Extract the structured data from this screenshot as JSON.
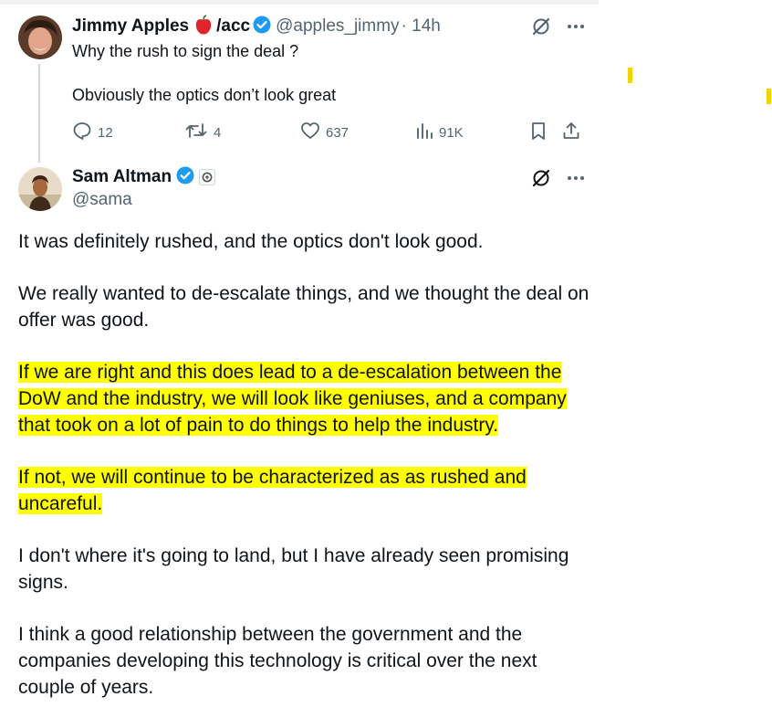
{
  "quoted_tweet": {
    "author_name": "Jimmy Apples",
    "author_suffix": "/acc",
    "handle": "@apples_jimmy",
    "time": "· 14h",
    "lines": [
      "Why the rush to sign the deal ?",
      "Obviously the optics don’t look great"
    ],
    "reply_count": "12",
    "retweet_count": "4",
    "like_count": "637",
    "view_count": "91K"
  },
  "main_tweet": {
    "author_name": "Sam Altman",
    "handle": "@sama",
    "paragraphs": [
      "It was definitely rushed, and the optics don't look good.",
      "We really wanted to de-escalate things, and we thought the deal on offer was good.",
      "If we are right and this does lead to a de-escalation between the DoW and the industry, we will look like geniuses, and a company that took on a lot of pain to do things to help the industry.",
      "If not, we will continue to be characterized as as rushed and uncareful.",
      "I don't where it's going to land, but I have already seen promising signs.",
      "I think a good relationship between the government and the companies developing this technology is critical over the next couple of years."
    ]
  },
  "colors": {
    "highlight": "#ffff00",
    "verified": "#1d9bf0",
    "muted": "#536471"
  },
  "icons": [
    "grok-icon",
    "more-icon",
    "reply-icon",
    "retweet-icon",
    "like-icon",
    "views-icon",
    "bookmark-icon",
    "share-icon",
    "verified-icon",
    "apple-icon"
  ]
}
